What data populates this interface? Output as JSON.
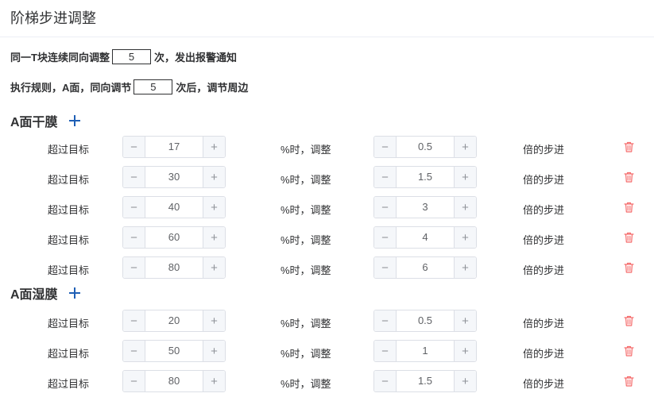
{
  "page": {
    "title": "阶梯步进调整"
  },
  "rules": {
    "line1": {
      "prefix": "同一T块连续同向调整",
      "value": "5",
      "suffix": "次，发出报警通知"
    },
    "line2": {
      "prefix": "执行规则，A面，同向调节",
      "value": "5",
      "suffix": "次后，调节周边"
    }
  },
  "icons": {
    "add": "plus-icon",
    "delete": "trash-icon",
    "minus": "minus-icon",
    "plus": "plus-icon"
  },
  "colors": {
    "accent": "#1f5fb5",
    "delete": "#f56c6c"
  },
  "labels": {
    "over": "超过目标",
    "adjust": "%时，调整",
    "step": "倍的步进",
    "minus": "−",
    "plus": "+"
  },
  "sections": [
    {
      "title": "A面干膜",
      "rows": [
        {
          "threshold": "17",
          "step": "0.5"
        },
        {
          "threshold": "30",
          "step": "1.5"
        },
        {
          "threshold": "40",
          "step": "3"
        },
        {
          "threshold": "60",
          "step": "4"
        },
        {
          "threshold": "80",
          "step": "6"
        }
      ]
    },
    {
      "title": "A面湿膜",
      "rows": [
        {
          "threshold": "20",
          "step": "0.5"
        },
        {
          "threshold": "50",
          "step": "1"
        },
        {
          "threshold": "80",
          "step": "1.5"
        }
      ]
    }
  ]
}
